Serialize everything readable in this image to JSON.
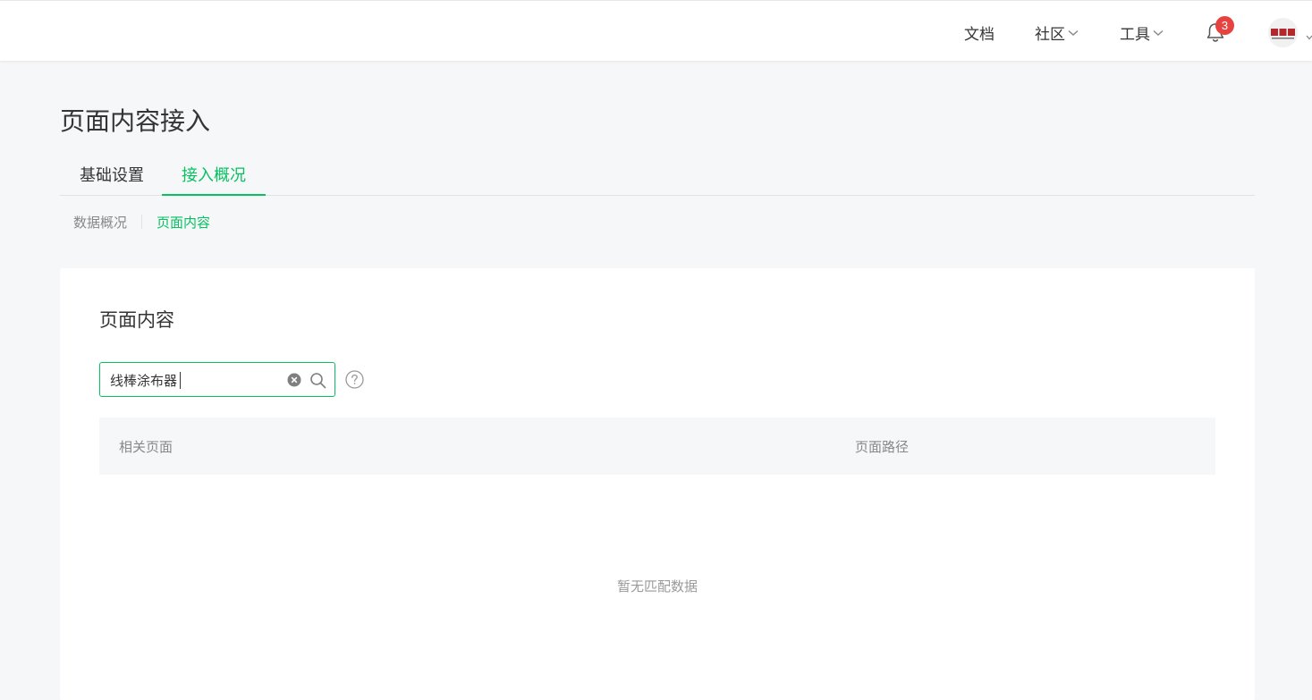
{
  "topbar": {
    "nav": {
      "docs": "文档",
      "community": "社区",
      "tools": "工具"
    },
    "notifications": {
      "count": "3"
    },
    "avatar_icon": "avatar-logo"
  },
  "page": {
    "title": "页面内容接入",
    "tabs": [
      "基础设置",
      "接入概况"
    ],
    "active_tab": "接入概况",
    "subtabs": [
      "数据概况",
      "页面内容"
    ],
    "active_subtab": "页面内容"
  },
  "content": {
    "card_title": "页面内容",
    "search": {
      "value": "线棒涂布器"
    },
    "table": {
      "columns": [
        "相关页面",
        "页面路径"
      ],
      "empty_text": "暂无匹配数据"
    }
  },
  "colors": {
    "accent": "#07c160",
    "badge": "#e64340",
    "page_background": "#f6f7f8"
  }
}
